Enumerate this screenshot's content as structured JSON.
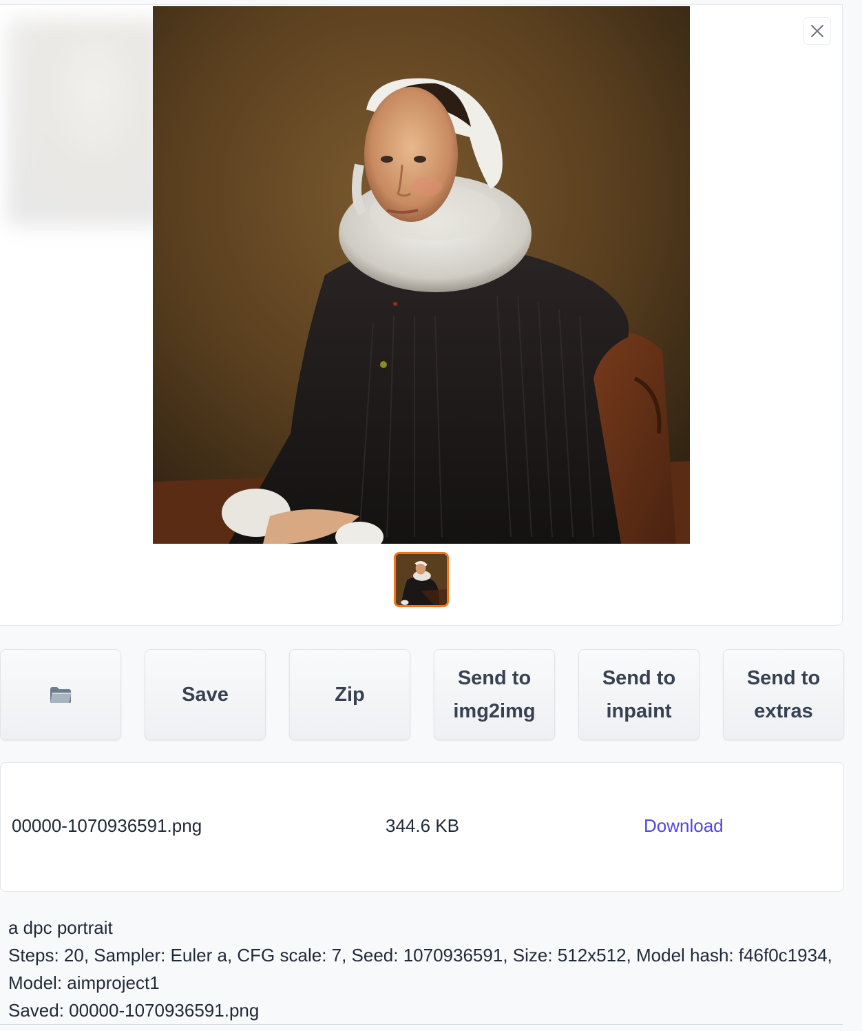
{
  "gallery": {
    "main_image_alt": "",
    "close_icon": "close-icon",
    "selected_thumbnail_border": "#f97316"
  },
  "buttons": {
    "folder_icon": "folder-icon",
    "save_label": "Save",
    "zip_label": "Zip",
    "img2img_label": "Send to img2img",
    "inpaint_label": "Send to inpaint",
    "extras_label": "Send to extras"
  },
  "file": {
    "name": "00000-1070936591.png",
    "size": "344.6 KB",
    "download_label": "Download",
    "link_color": "#4f46e5"
  },
  "info": {
    "prompt": "a dpc portrait",
    "params": "Steps: 20, Sampler: Euler a, CFG scale: 7, Seed: 1070936591, Size: 512x512, Model hash: f46f0c1934, Model: aimproject1",
    "saved": "Saved: 00000-1070936591.png"
  }
}
